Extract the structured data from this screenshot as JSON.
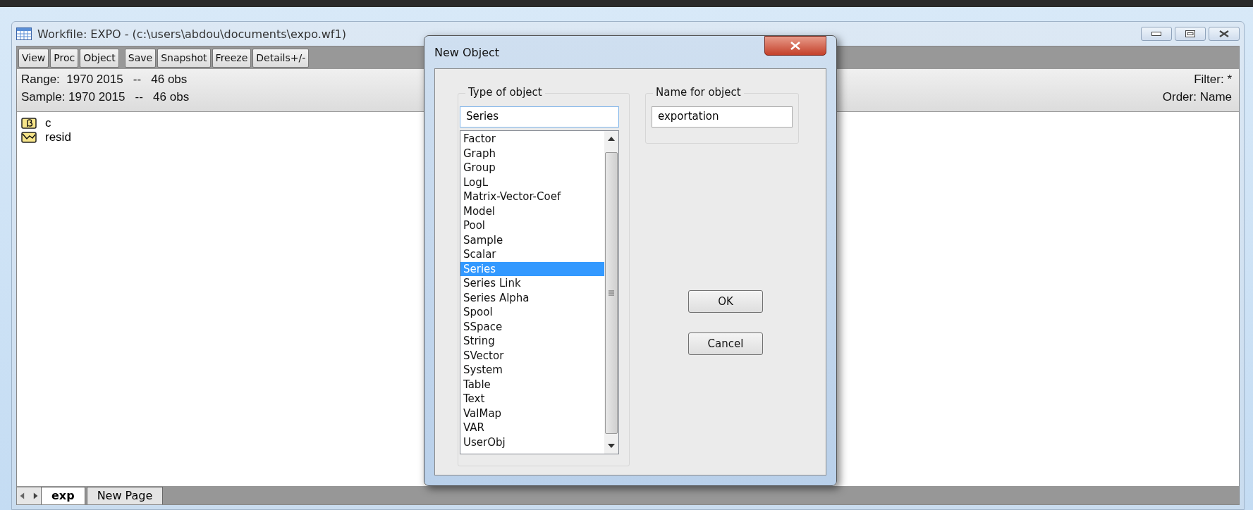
{
  "window": {
    "title": "Workfile: EXPO - (c:\\users\\abdou\\documents\\expo.wf1)"
  },
  "toolbar_groups": [
    [
      "View",
      "Proc",
      "Object"
    ],
    [
      "Save",
      "Snapshot",
      "Freeze",
      "Details+/-"
    ]
  ],
  "info": {
    "left": [
      "Range:  1970 2015   --   46 obs",
      "Sample: 1970 2015   --   46 obs"
    ],
    "right": [
      "Filter: *",
      "Order: Name"
    ]
  },
  "objects": [
    {
      "name": "c",
      "kind": "coef"
    },
    {
      "name": "resid",
      "kind": "series"
    }
  ],
  "sheet_tabs": [
    {
      "label": "exp",
      "selected": true
    },
    {
      "label": "New Page",
      "selected": false
    }
  ],
  "dialog": {
    "title": "New Object",
    "type_group": {
      "label": "Type of object",
      "value": "Series",
      "items": [
        {
          "label": "Factor",
          "selected": false
        },
        {
          "label": "Graph",
          "selected": false
        },
        {
          "label": "Group",
          "selected": false
        },
        {
          "label": "LogL",
          "selected": false
        },
        {
          "label": "Matrix-Vector-Coef",
          "selected": false
        },
        {
          "label": "Model",
          "selected": false
        },
        {
          "label": "Pool",
          "selected": false
        },
        {
          "label": "Sample",
          "selected": false
        },
        {
          "label": "Scalar",
          "selected": false
        },
        {
          "label": "Series",
          "selected": true
        },
        {
          "label": "Series Link",
          "selected": false
        },
        {
          "label": "Series Alpha",
          "selected": false
        },
        {
          "label": "Spool",
          "selected": false
        },
        {
          "label": "SSpace",
          "selected": false
        },
        {
          "label": "String",
          "selected": false
        },
        {
          "label": "SVector",
          "selected": false
        },
        {
          "label": "System",
          "selected": false
        },
        {
          "label": "Table",
          "selected": false
        },
        {
          "label": "Text",
          "selected": false
        },
        {
          "label": "ValMap",
          "selected": false
        },
        {
          "label": "VAR",
          "selected": false
        },
        {
          "label": "UserObj",
          "selected": false
        }
      ]
    },
    "name_group": {
      "label": "Name for object",
      "value": "exportation"
    },
    "buttons": [
      "OK",
      "Cancel"
    ]
  }
}
